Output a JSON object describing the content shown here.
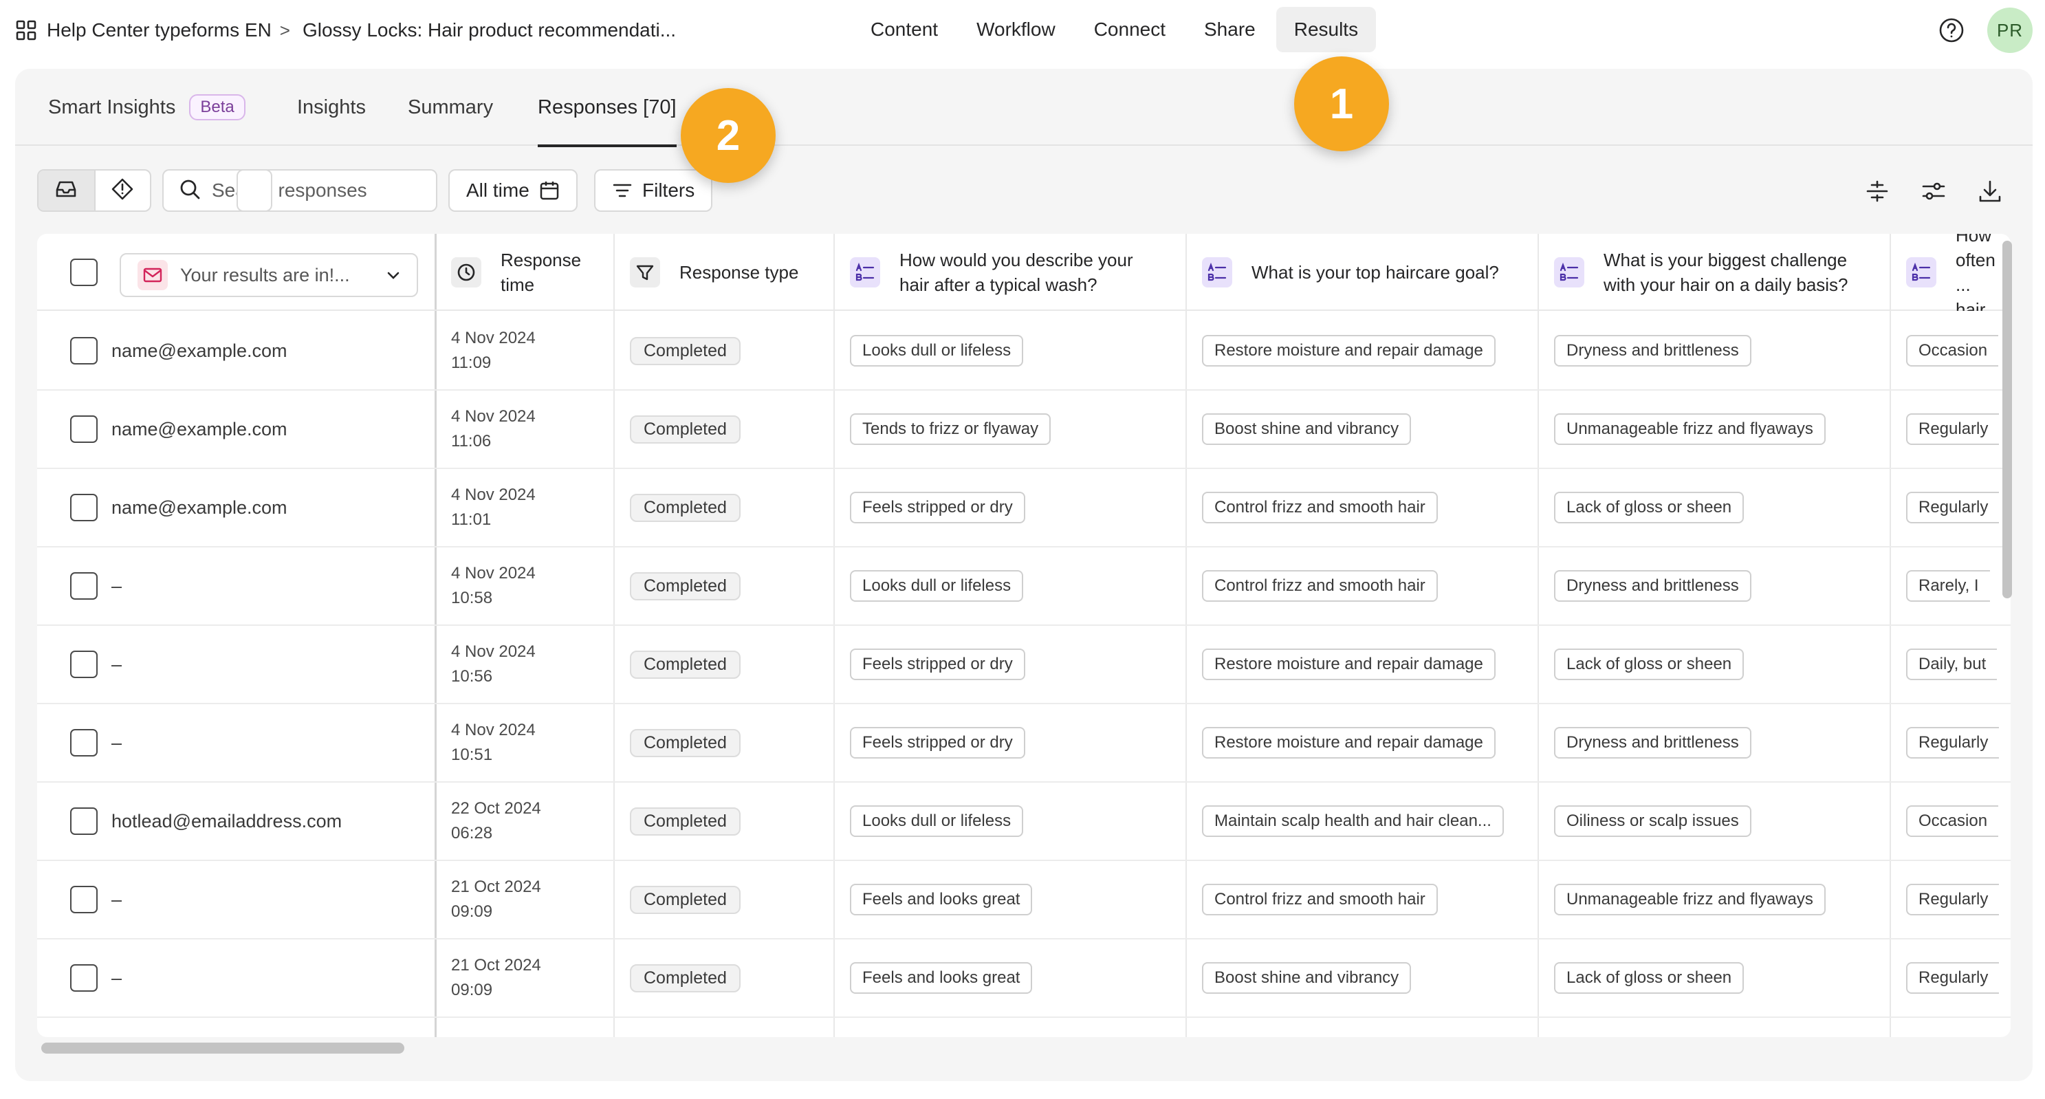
{
  "breadcrumb": {
    "workspace": "Help Center typeforms EN",
    "separator": ">",
    "form": "Glossy Locks: Hair product recommendati..."
  },
  "topnav": [
    {
      "label": "Content",
      "active": false
    },
    {
      "label": "Workflow",
      "active": false
    },
    {
      "label": "Connect",
      "active": false
    },
    {
      "label": "Share",
      "active": false
    },
    {
      "label": "Results",
      "active": true
    }
  ],
  "user": {
    "initials": "PR"
  },
  "tabs": {
    "smart_insights": "Smart Insights",
    "beta": "Beta",
    "insights": "Insights",
    "summary": "Summary",
    "responses": "Responses [70]"
  },
  "toolbar": {
    "search_placeholder": "Search responses",
    "date_range": "All time",
    "filters": "Filters"
  },
  "columns": {
    "email_select": "Your results are in!...",
    "response_time": "Response time",
    "response_type": "Response type",
    "q1": "How would you describe your hair after a typical wash?",
    "q2": "What is your top haircare goal?",
    "q3": "What is your biggest challenge with your hair on a daily basis?",
    "q4": "How often ... hair..."
  },
  "rows": [
    {
      "email": "name@example.com",
      "date": "4 Nov 2024",
      "time": "11:09",
      "status": "Completed",
      "q1": "Looks dull or lifeless",
      "q2": "Restore moisture and repair damage",
      "q3": "Dryness and brittleness",
      "q4": "Occasion"
    },
    {
      "email": "name@example.com",
      "date": "4 Nov 2024",
      "time": "11:06",
      "status": "Completed",
      "q1": "Tends to frizz or flyaway",
      "q2": "Boost shine and vibrancy",
      "q3": "Unmanageable frizz and flyaways",
      "q4": "Regularly"
    },
    {
      "email": "name@example.com",
      "date": "4 Nov 2024",
      "time": "11:01",
      "status": "Completed",
      "q1": "Feels stripped or dry",
      "q2": "Control frizz and smooth hair",
      "q3": "Lack of gloss or sheen",
      "q4": "Regularly"
    },
    {
      "email": "–",
      "date": "4 Nov 2024",
      "time": "10:58",
      "status": "Completed",
      "q1": "Looks dull or lifeless",
      "q2": "Control frizz and smooth hair",
      "q3": "Dryness and brittleness",
      "q4": "Rarely, I"
    },
    {
      "email": "–",
      "date": "4 Nov 2024",
      "time": "10:56",
      "status": "Completed",
      "q1": "Feels stripped or dry",
      "q2": "Restore moisture and repair damage",
      "q3": "Lack of gloss or sheen",
      "q4": "Daily, but"
    },
    {
      "email": "–",
      "date": "4 Nov 2024",
      "time": "10:51",
      "status": "Completed",
      "q1": "Feels stripped or dry",
      "q2": "Restore moisture and repair damage",
      "q3": "Dryness and brittleness",
      "q4": "Regularly"
    },
    {
      "email": "hotlead@emailaddress.com",
      "date": "22 Oct 2024",
      "time": "06:28",
      "status": "Completed",
      "q1": "Looks dull or lifeless",
      "q2": "Maintain scalp health and hair clean...",
      "q3": "Oiliness or scalp issues",
      "q4": "Occasion"
    },
    {
      "email": "–",
      "date": "21 Oct 2024",
      "time": "09:09",
      "status": "Completed",
      "q1": "Feels and looks great",
      "q2": "Control frizz and smooth hair",
      "q3": "Unmanageable frizz and flyaways",
      "q4": "Regularly"
    },
    {
      "email": "–",
      "date": "21 Oct 2024",
      "time": "09:09",
      "status": "Completed",
      "q1": "Feels and looks great",
      "q2": "Boost shine and vibrancy",
      "q3": "Lack of gloss or sheen",
      "q4": "Regularly"
    }
  ],
  "annotations": [
    "1",
    "2"
  ],
  "colors": {
    "accent_badge": "#f6a821",
    "avatar_bg": "#c9ecc6",
    "question_icon_bg": "#e8e1fb",
    "beta_border": "#d9b6ea"
  },
  "icons": {
    "app_grid": "grid-icon",
    "help": "help-circle-icon",
    "inbox": "inbox-icon",
    "insight": "diamond-icon",
    "search": "search-icon",
    "calendar": "calendar-icon",
    "filter": "filter-icon",
    "columns": "columns-icon",
    "sliders": "sliders-icon",
    "download": "download-icon",
    "mail": "mail-icon",
    "clock": "clock-icon",
    "funnel": "funnel-icon",
    "multiple_choice": "multiple-choice-icon"
  }
}
